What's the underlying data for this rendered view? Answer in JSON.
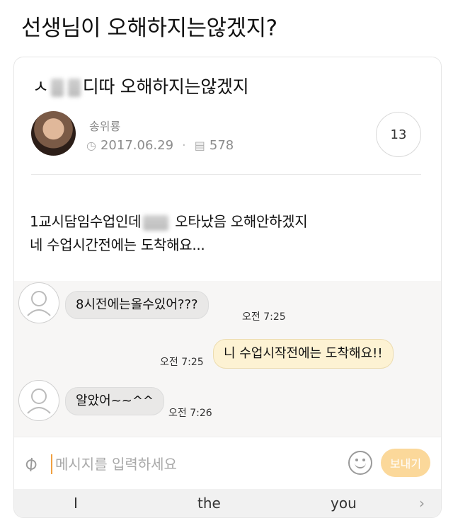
{
  "page_title": "선생님이 오해하지는않겠지?",
  "post": {
    "title_prefix": "ㅅ",
    "title_suffix": "디따 오해하지는않겠지",
    "author": "송위룡",
    "date": "2017.06.29",
    "views": "578",
    "comment_count": "13",
    "body_line1_start": "1교시담임수업인데",
    "body_line1_end": "오타났음 오해안하겠지",
    "body_line2": "네 수업시간전에는 도착해요..."
  },
  "chat": {
    "messages": [
      {
        "side": "left",
        "text": "8시전에는올수있어???",
        "time": "오전 7:25"
      },
      {
        "side": "right",
        "text": "니 수업시작전에는 도착해요!!",
        "time": "오전 7:25"
      },
      {
        "side": "left",
        "text": "알았어~~^^",
        "time": "오전 7:26"
      }
    ]
  },
  "input": {
    "placeholder": "메시지를 입력하세요",
    "send_label": "보내기"
  },
  "keyboard": {
    "suggestions": [
      "I",
      "the",
      "you"
    ],
    "more": "›"
  },
  "icons": {
    "attach": "paperclip-icon",
    "emoji": "smiley-icon",
    "clock": "clock-icon",
    "views": "document-icon"
  },
  "colors": {
    "accent": "#fbd89a",
    "my_bubble": "#fdf2d3",
    "their_bubble": "#e9e8e7"
  }
}
